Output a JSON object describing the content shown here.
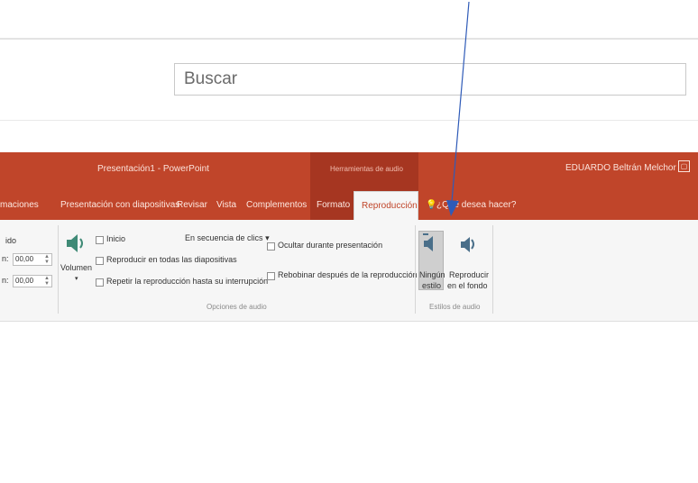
{
  "search": {
    "placeholder": "Buscar"
  },
  "title_bar": {
    "title": "Presentación1 - PowerPoint",
    "context_label": "Herramientas de audio",
    "user": "EDUARDO Beltrán Melchor",
    "window_icon": "restore-icon"
  },
  "tabs": [
    {
      "label": "maciones"
    },
    {
      "label": "Presentación con diapositivas"
    },
    {
      "label": "Revisar"
    },
    {
      "label": "Vista"
    },
    {
      "label": "Complementos"
    },
    {
      "label": "Formato"
    },
    {
      "label": "Reproducción",
      "active": true
    }
  ],
  "tell_me": {
    "label": "¿Qué desea hacer?",
    "icon": "lightbulb-icon"
  },
  "ribbon": {
    "fade_group": {
      "label": "ido",
      "fade_in_value": "00,00",
      "fade_out_value": "00,00"
    },
    "volume": {
      "label": "Volumen",
      "icon": "speaker-icon"
    },
    "options": {
      "start_label": "Inicio",
      "start_value": "En secuencia de clics",
      "play_across_slides": "Reproducir en todas las diapositivas",
      "loop_until_stopped": "Repetir la reproducción hasta su interrupción",
      "hide_during_show": "Ocultar durante presentación",
      "rewind_after_playing": "Rebobinar después de la reproducción",
      "group_label": "Opciones de audio"
    },
    "audio_styles": {
      "no_style_label_1": "Ningún",
      "no_style_label_2": "estilo",
      "play_background_label_1": "Reproducir",
      "play_background_label_2": "en el fondo",
      "group_label": "Estilos de audio"
    }
  },
  "colors": {
    "title_bar": "#c0452a",
    "context_tab": "#a63621",
    "ribbon_bg": "#f6f6f6",
    "arrow": "#2f5bb8"
  }
}
